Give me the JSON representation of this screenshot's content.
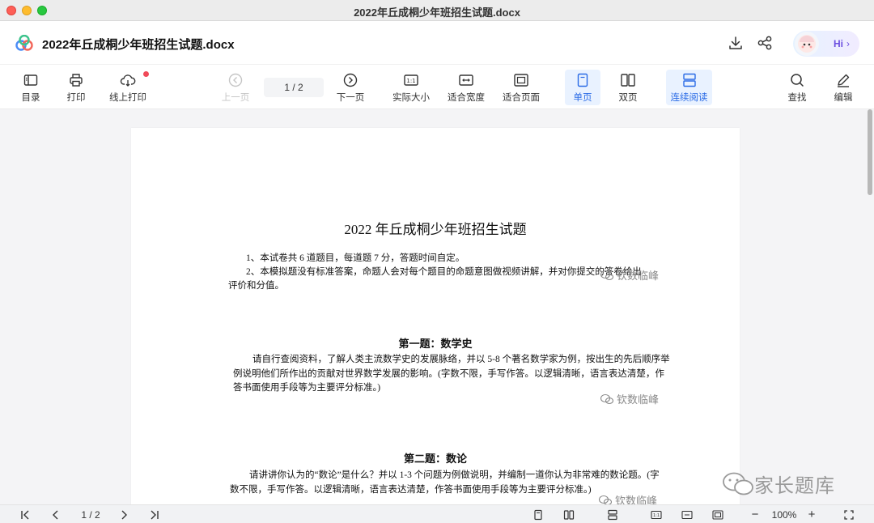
{
  "window": {
    "title": "2022年丘成桐少年班招生试题.docx"
  },
  "header": {
    "doc_title": "2022年丘成桐少年班招生试题.docx",
    "assistant_label": "Hi",
    "assistant_chevron": "›"
  },
  "toolbar": {
    "toc": "目录",
    "print": "打印",
    "online_print": "线上打印",
    "prev_page": "上一页",
    "page_indicator": "1 / 2",
    "next_page": "下一页",
    "actual_size": "实际大小",
    "fit_width": "适合宽度",
    "fit_page": "适合页面",
    "single_page": "单页",
    "double_page": "双页",
    "continuous": "连续阅读",
    "find": "查找",
    "edit": "编辑"
  },
  "document": {
    "heading": "2022 年丘成桐少年班招生试题",
    "notes": [
      "1、本试卷共 6 道题目，每道题 7 分，答题时间自定。",
      "2、本模拟题没有标准答案，命题人会对每个题目的命题意图做视频讲解，并对你提交的答卷给出",
      "评价和分值。"
    ],
    "sections": [
      {
        "title": "第一题：数学史",
        "lines": [
          "请自行查阅资料，了解人类主流数学史的发展脉络，并以 5-8 个著名数学家为例，按出生的先后顺序举",
          "例说明他们所作出的贡献对世界数学发展的影响。(字数不限，手写作答。以逻辑清晰，语言表达清楚，作",
          "答书面使用手段等为主要评分标准。)"
        ]
      },
      {
        "title": "第二题：数论",
        "lines": [
          "请讲讲你认为的“数论”是什么？并以 1-3 个问题为例做说明，并编制一道你认为非常难的数论题。(字",
          "数不限，手写作答。以逻辑清晰，语言表达清楚，作答书面使用手段等为主要评分标准。)"
        ]
      }
    ],
    "watermarks": [
      "钦数临峰",
      "钦数临峰",
      "钦数临峰"
    ],
    "overlay_watermark": "家长题库"
  },
  "statusbar": {
    "page_indicator": "1 / 2",
    "zoom": "100%",
    "zoom_minus": "−",
    "zoom_plus": "+"
  },
  "colors": {
    "accent": "#2a6be6",
    "active_bg": "#e9f2ff",
    "badge_red": "#f04a59"
  }
}
